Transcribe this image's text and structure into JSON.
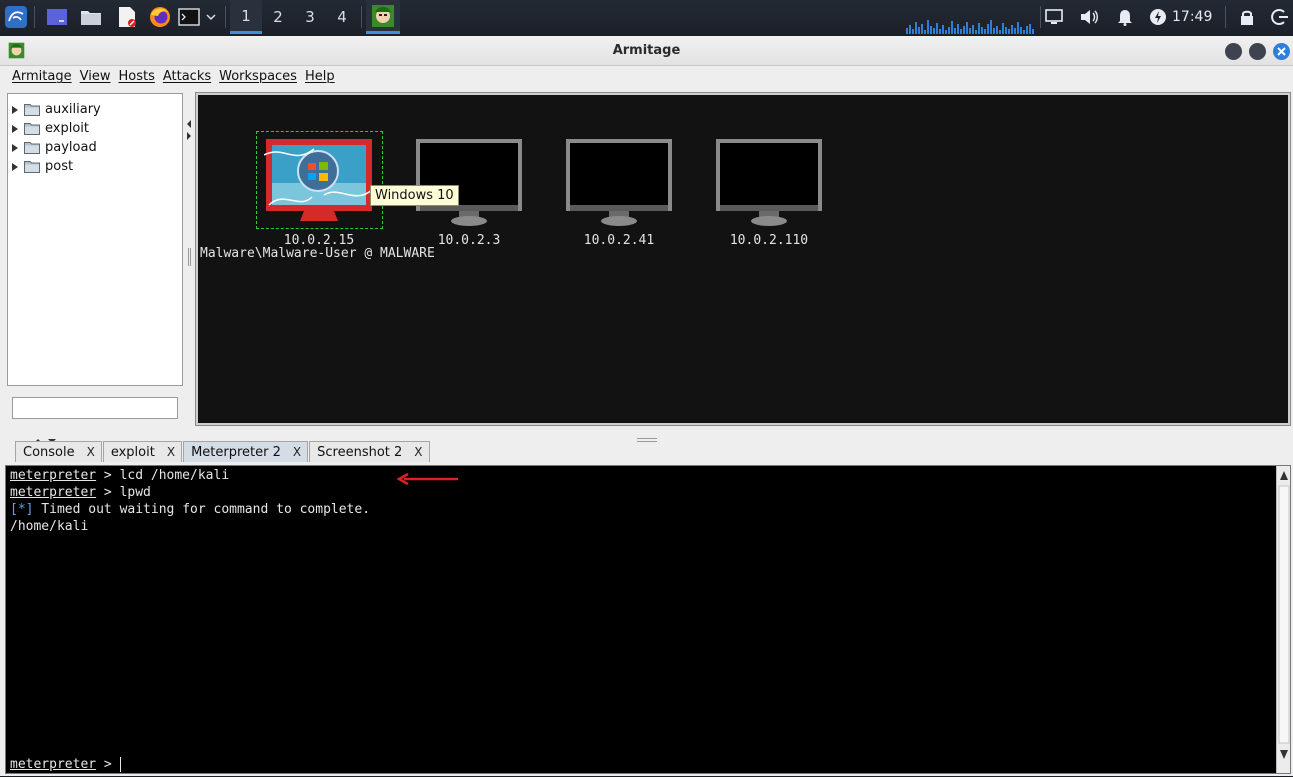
{
  "panel": {
    "workspaces": [
      "1",
      "2",
      "3",
      "4"
    ],
    "active_workspace": "1",
    "clock": "17:49",
    "icons": [
      "kali-menu-icon",
      "show-desktop-icon",
      "file-manager-icon",
      "text-editor-icon",
      "firefox-icon",
      "terminal-icon",
      "armitage-taskbar-icon",
      "display-icon",
      "volume-icon",
      "notification-bell-icon",
      "power-manager-icon",
      "lock-icon",
      "logout-icon"
    ]
  },
  "window": {
    "title": "Armitage"
  },
  "menubar": {
    "items": [
      "Armitage",
      "View",
      "Hosts",
      "Attacks",
      "Workspaces",
      "Help"
    ]
  },
  "tree": {
    "items": [
      "auxiliary",
      "exploit",
      "payload",
      "post"
    ]
  },
  "search": {
    "value": ""
  },
  "graph": {
    "hosts": [
      {
        "ip": "10.0.2.15",
        "state": "compromised"
      },
      {
        "ip": "10.0.2.3",
        "state": "unknown"
      },
      {
        "ip": "10.0.2.41",
        "state": "unknown"
      },
      {
        "ip": "10.0.2.110",
        "state": "unknown"
      }
    ],
    "session_label": "Malware\\Malware-User @ MALWARE",
    "tooltip": "Windows 10"
  },
  "tabs": [
    {
      "label": "Console",
      "close": "X"
    },
    {
      "label": "exploit",
      "close": "X"
    },
    {
      "label": "Meterpreter 2",
      "close": "X",
      "active": true
    },
    {
      "label": "Screenshot 2",
      "close": "X"
    }
  ],
  "console": {
    "prompt": "meterpreter",
    "lines": [
      {
        "prompt": "meterpreter",
        "text": " > lcd /home/kali"
      },
      {
        "prompt": "meterpreter",
        "text": " > lpwd"
      },
      {
        "marker": "[*]",
        "text": " Timed out waiting for command to complete."
      },
      {
        "text": "/home/kali"
      }
    ],
    "input_prompt_suffix": " > "
  },
  "colors": {
    "accent": "#3c8ee0",
    "annotation_arrow": "#e02020",
    "selection": "#2ecc2e"
  }
}
